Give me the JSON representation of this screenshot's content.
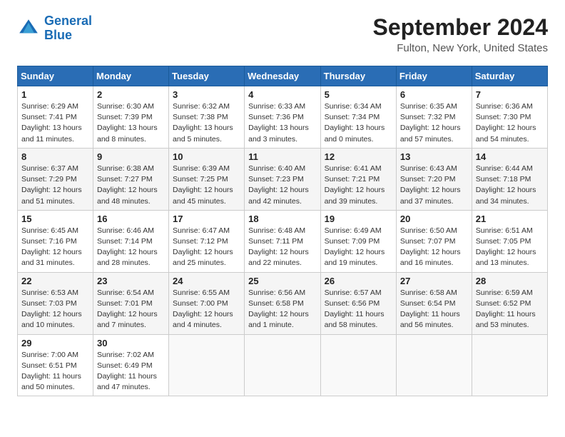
{
  "header": {
    "logo_line1": "General",
    "logo_line2": "Blue",
    "title": "September 2024",
    "subtitle": "Fulton, New York, United States"
  },
  "calendar": {
    "headers": [
      "Sunday",
      "Monday",
      "Tuesday",
      "Wednesday",
      "Thursday",
      "Friday",
      "Saturday"
    ],
    "weeks": [
      [
        {
          "day": "1",
          "sunrise": "6:29 AM",
          "sunset": "7:41 PM",
          "daylight": "13 hours and 11 minutes."
        },
        {
          "day": "2",
          "sunrise": "6:30 AM",
          "sunset": "7:39 PM",
          "daylight": "13 hours and 8 minutes."
        },
        {
          "day": "3",
          "sunrise": "6:32 AM",
          "sunset": "7:38 PM",
          "daylight": "13 hours and 5 minutes."
        },
        {
          "day": "4",
          "sunrise": "6:33 AM",
          "sunset": "7:36 PM",
          "daylight": "13 hours and 3 minutes."
        },
        {
          "day": "5",
          "sunrise": "6:34 AM",
          "sunset": "7:34 PM",
          "daylight": "13 hours and 0 minutes."
        },
        {
          "day": "6",
          "sunrise": "6:35 AM",
          "sunset": "7:32 PM",
          "daylight": "12 hours and 57 minutes."
        },
        {
          "day": "7",
          "sunrise": "6:36 AM",
          "sunset": "7:30 PM",
          "daylight": "12 hours and 54 minutes."
        }
      ],
      [
        {
          "day": "8",
          "sunrise": "6:37 AM",
          "sunset": "7:29 PM",
          "daylight": "12 hours and 51 minutes."
        },
        {
          "day": "9",
          "sunrise": "6:38 AM",
          "sunset": "7:27 PM",
          "daylight": "12 hours and 48 minutes."
        },
        {
          "day": "10",
          "sunrise": "6:39 AM",
          "sunset": "7:25 PM",
          "daylight": "12 hours and 45 minutes."
        },
        {
          "day": "11",
          "sunrise": "6:40 AM",
          "sunset": "7:23 PM",
          "daylight": "12 hours and 42 minutes."
        },
        {
          "day": "12",
          "sunrise": "6:41 AM",
          "sunset": "7:21 PM",
          "daylight": "12 hours and 39 minutes."
        },
        {
          "day": "13",
          "sunrise": "6:43 AM",
          "sunset": "7:20 PM",
          "daylight": "12 hours and 37 minutes."
        },
        {
          "day": "14",
          "sunrise": "6:44 AM",
          "sunset": "7:18 PM",
          "daylight": "12 hours and 34 minutes."
        }
      ],
      [
        {
          "day": "15",
          "sunrise": "6:45 AM",
          "sunset": "7:16 PM",
          "daylight": "12 hours and 31 minutes."
        },
        {
          "day": "16",
          "sunrise": "6:46 AM",
          "sunset": "7:14 PM",
          "daylight": "12 hours and 28 minutes."
        },
        {
          "day": "17",
          "sunrise": "6:47 AM",
          "sunset": "7:12 PM",
          "daylight": "12 hours and 25 minutes."
        },
        {
          "day": "18",
          "sunrise": "6:48 AM",
          "sunset": "7:11 PM",
          "daylight": "12 hours and 22 minutes."
        },
        {
          "day": "19",
          "sunrise": "6:49 AM",
          "sunset": "7:09 PM",
          "daylight": "12 hours and 19 minutes."
        },
        {
          "day": "20",
          "sunrise": "6:50 AM",
          "sunset": "7:07 PM",
          "daylight": "12 hours and 16 minutes."
        },
        {
          "day": "21",
          "sunrise": "6:51 AM",
          "sunset": "7:05 PM",
          "daylight": "12 hours and 13 minutes."
        }
      ],
      [
        {
          "day": "22",
          "sunrise": "6:53 AM",
          "sunset": "7:03 PM",
          "daylight": "12 hours and 10 minutes."
        },
        {
          "day": "23",
          "sunrise": "6:54 AM",
          "sunset": "7:01 PM",
          "daylight": "12 hours and 7 minutes."
        },
        {
          "day": "24",
          "sunrise": "6:55 AM",
          "sunset": "7:00 PM",
          "daylight": "12 hours and 4 minutes."
        },
        {
          "day": "25",
          "sunrise": "6:56 AM",
          "sunset": "6:58 PM",
          "daylight": "12 hours and 1 minute."
        },
        {
          "day": "26",
          "sunrise": "6:57 AM",
          "sunset": "6:56 PM",
          "daylight": "11 hours and 58 minutes."
        },
        {
          "day": "27",
          "sunrise": "6:58 AM",
          "sunset": "6:54 PM",
          "daylight": "11 hours and 56 minutes."
        },
        {
          "day": "28",
          "sunrise": "6:59 AM",
          "sunset": "6:52 PM",
          "daylight": "11 hours and 53 minutes."
        }
      ],
      [
        {
          "day": "29",
          "sunrise": "7:00 AM",
          "sunset": "6:51 PM",
          "daylight": "11 hours and 50 minutes."
        },
        {
          "day": "30",
          "sunrise": "7:02 AM",
          "sunset": "6:49 PM",
          "daylight": "11 hours and 47 minutes."
        },
        null,
        null,
        null,
        null,
        null
      ]
    ]
  }
}
